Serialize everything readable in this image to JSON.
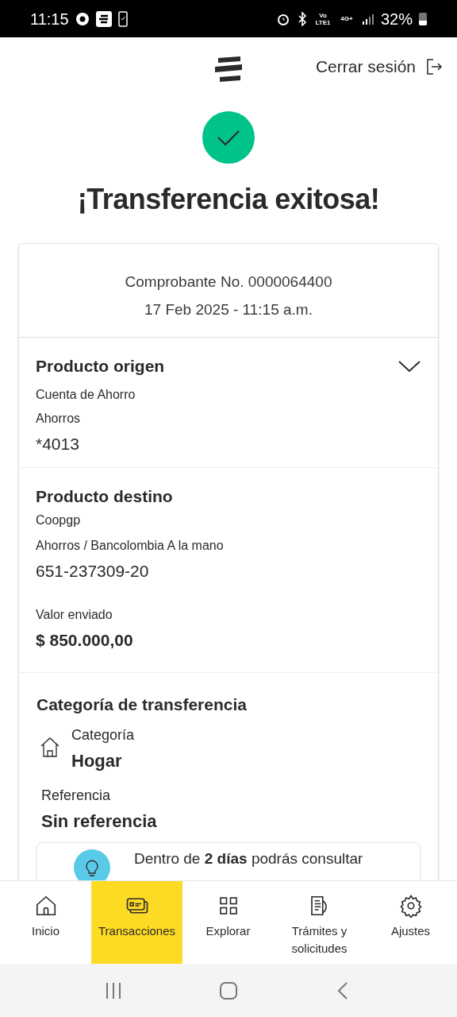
{
  "status_bar": {
    "time": "11:15",
    "network_labels": [
      "Vo LTE1",
      "4G+"
    ],
    "battery": "32%"
  },
  "header": {
    "logout": "Cerrar sesión"
  },
  "title": "¡Transferencia exitosa!",
  "receipt": {
    "number": "Comprobante No. 0000064400",
    "datetime": "17 Feb 2025 - 11:15 a.m."
  },
  "origin": {
    "heading": "Producto origen",
    "expanded": false,
    "lines": [
      "Cuenta de Ahorro",
      "Ahorros"
    ],
    "account": "*4013"
  },
  "destination": {
    "heading": "Producto destino",
    "lines": [
      "Coopgp",
      "Ahorros / Bancolombia A la mano"
    ],
    "account": "651-237309-20",
    "amount_label": "Valor enviado",
    "amount": "$ 850.000,00"
  },
  "category": {
    "heading": "Categoría de transferencia",
    "label": "Categoría",
    "value": "Hogar",
    "reference_label": "Referencia",
    "reference": "Sin referencia"
  },
  "tip": "Dentro de **2 días** podrás consultar",
  "nav": [
    {
      "label": "Inicio",
      "selected": false
    },
    {
      "label": "Transacciones",
      "selected": true
    },
    {
      "label": "Explorar",
      "selected": false
    },
    {
      "label": "Trámites y solicitudes",
      "selected": false
    },
    {
      "label": "Ajustes",
      "selected": false
    }
  ]
}
